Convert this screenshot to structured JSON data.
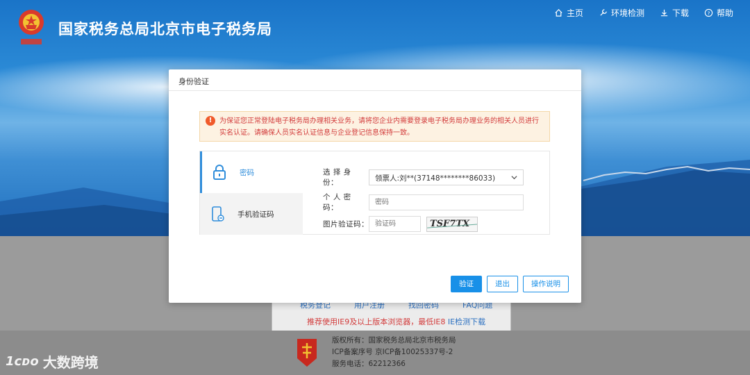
{
  "site": {
    "title": "国家税务总局北京市电子税务局",
    "nav": [
      {
        "label": "主页",
        "icon": "home-icon"
      },
      {
        "label": "环境检测",
        "icon": "wrench-icon"
      },
      {
        "label": "下载",
        "icon": "download-icon"
      },
      {
        "label": "帮助",
        "icon": "help-icon"
      }
    ]
  },
  "background": {
    "links": [
      "税务登记",
      "用户注册",
      "找回密码",
      "FAQ问题"
    ],
    "browser_notice": "推荐使用IE9及以上版本浏览器，最低IE8",
    "browser_link": "IE检测下载",
    "footer_lines": [
      "版权所有：国家税务总局北京市税务局",
      "ICP备案序号 京ICP备10025337号-2",
      "服务电话：62212366"
    ],
    "watermark": "大数跨境",
    "watermark_mark": "1ᴄᴅᴏ"
  },
  "dialog": {
    "title": "身份验证",
    "warning": "为保证您正常登陆电子税务局办理相关业务，请将您企业内需要登录电子税务局办理业务的相关人员进行实名认证。请确保人员实名认证信息与企业登记信息保持一致。",
    "tabs": [
      {
        "label": "密码",
        "icon": "lock-icon",
        "active": true
      },
      {
        "label": "手机验证码",
        "icon": "phone-icon",
        "active": false
      }
    ],
    "form": {
      "identity_label": "选 择 身 份：",
      "identity_value": "领票人:刘**(37148********86033)",
      "password_label": "个 人 密 码：",
      "password_placeholder": "密码",
      "captcha_label": "图片验证码：",
      "captcha_placeholder": "验证码",
      "captcha_text": "TSF7TX"
    },
    "buttons": {
      "verify": "验证",
      "exit": "退出",
      "help": "操作说明"
    }
  },
  "colors": {
    "primary": "#1890e8",
    "warning_text": "#d23b3b",
    "warning_bg": "#fdf2e2"
  }
}
